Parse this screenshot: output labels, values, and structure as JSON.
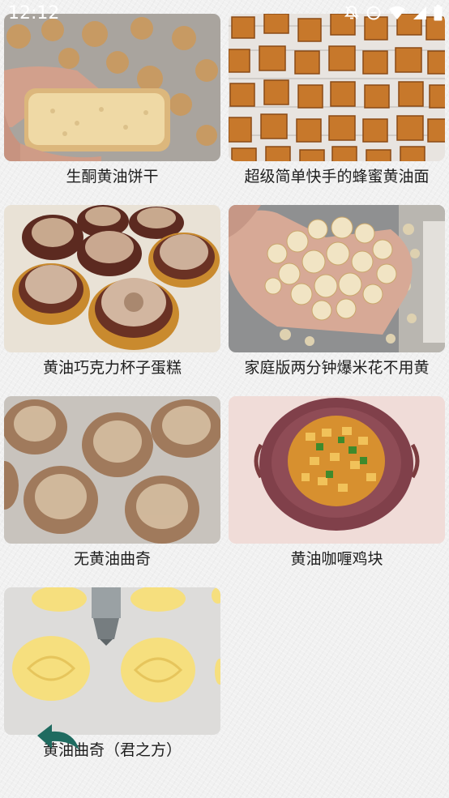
{
  "status_bar": {
    "time": "12:12",
    "icons": [
      "notifications-off-icon",
      "data-saver-icon",
      "wifi-icon",
      "signal-icon",
      "battery-icon"
    ]
  },
  "recipes": [
    {
      "title": "生酮黄油饼干",
      "image": "keto-butter-biscuit-photo"
    },
    {
      "title": "超级简单快手的蜂蜜黄油面",
      "image": "honey-butter-toast-cubes-photo"
    },
    {
      "title": "黄油巧克力杯子蛋糕",
      "image": "chocolate-cupcakes-photo"
    },
    {
      "title": "家庭版两分钟爆米花不用黄",
      "image": "popcorn-in-hand-photo"
    },
    {
      "title": "无黄油曲奇",
      "image": "butterless-cookies-photo"
    },
    {
      "title": "黄油咖喱鸡块",
      "image": "butter-curry-chicken-photo"
    },
    {
      "title": "黄油曲奇（君之方）",
      "image": "piped-butter-cookies-photo"
    }
  ],
  "nav": {
    "back_icon": "back-arrow-icon",
    "accent_color": "#1f6b60"
  }
}
